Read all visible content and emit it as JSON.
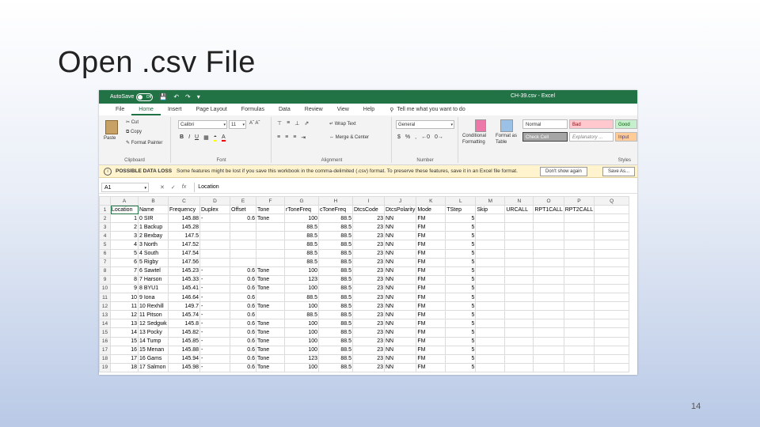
{
  "slide": {
    "title": "Open .csv File",
    "page_number": "14"
  },
  "excel": {
    "titlebar": {
      "autosave": "AutoSave",
      "toggle": "Off",
      "doc_title": "CH-39.csv - Excel"
    },
    "tabs": [
      "File",
      "Home",
      "Insert",
      "Page Layout",
      "Formulas",
      "Data",
      "Review",
      "View",
      "Help"
    ],
    "tell_me": "Tell me what you want to do",
    "ribbon": {
      "clipboard": {
        "paste": "Paste",
        "cut": "Cut",
        "copy": "Copy",
        "format_painter": "Format Painter",
        "label": "Clipboard"
      },
      "font": {
        "name": "Calibri",
        "size": "11",
        "label": "Font"
      },
      "alignment": {
        "wrap": "Wrap Text",
        "merge": "Merge & Center",
        "label": "Alignment"
      },
      "number": {
        "format": "General",
        "label": "Number"
      },
      "styles": {
        "conditional": "Conditional Formatting",
        "format_as_table": "Format as Table",
        "normal": "Normal",
        "bad": "Bad",
        "good": "Good",
        "check_cell": "Check Cell",
        "explanatory": "Explanatory ...",
        "input": "Input",
        "label": "Styles"
      }
    },
    "warning": {
      "title": "POSSIBLE DATA LOSS",
      "message": "Some features might be lost if you save this workbook in the comma-delimited (.csv) format. To preserve these features, save it in an Excel file format.",
      "dont_show": "Don't show again",
      "save_as": "Save As..."
    },
    "formula": {
      "name_box": "A1",
      "content": "Location"
    },
    "columns": [
      "A",
      "B",
      "C",
      "D",
      "E",
      "F",
      "G",
      "H",
      "I",
      "J",
      "K",
      "L",
      "M",
      "N",
      "O",
      "P",
      "Q"
    ],
    "headers": [
      "Location",
      "Name",
      "Frequency",
      "Duplex",
      "Offset",
      "Tone",
      "rToneFreq",
      "cToneFreq",
      "DtcsCode",
      "DtcsPolarity",
      "Mode",
      "TStep",
      "Skip",
      "URCALL",
      "RPT1CALL",
      "RPT2CALL",
      ""
    ],
    "rows": [
      [
        "1",
        "0 SIR",
        "145.88",
        "-",
        "0.6",
        "Tone",
        "100",
        "88.5",
        "23",
        "NN",
        "FM",
        "5",
        "",
        "",
        "",
        "",
        ""
      ],
      [
        "2",
        "1 Backup",
        "145.28",
        "",
        "",
        "",
        "88.5",
        "88.5",
        "23",
        "NN",
        "FM",
        "5",
        "",
        "",
        "",
        "",
        ""
      ],
      [
        "3",
        "2 Bexbay",
        "147.5",
        "",
        "",
        "",
        "88.5",
        "88.5",
        "23",
        "NN",
        "FM",
        "5",
        "",
        "",
        "",
        "",
        ""
      ],
      [
        "4",
        "3 North",
        "147.52",
        "",
        "",
        "",
        "88.5",
        "88.5",
        "23",
        "NN",
        "FM",
        "5",
        "",
        "",
        "",
        "",
        ""
      ],
      [
        "5",
        "4 South",
        "147.54",
        "",
        "",
        "",
        "88.5",
        "88.5",
        "23",
        "NN",
        "FM",
        "5",
        "",
        "",
        "",
        "",
        ""
      ],
      [
        "6",
        "5 Rigby",
        "147.56",
        "",
        "",
        "",
        "88.5",
        "88.5",
        "23",
        "NN",
        "FM",
        "5",
        "",
        "",
        "",
        "",
        ""
      ],
      [
        "7",
        "6 Sawtel",
        "145.23",
        "-",
        "0.6",
        "Tone",
        "100",
        "88.5",
        "23",
        "NN",
        "FM",
        "5",
        "",
        "",
        "",
        "",
        ""
      ],
      [
        "8",
        "7 Harson",
        "145.33",
        "-",
        "0.6",
        "Tone",
        "123",
        "88.5",
        "23",
        "NN",
        "FM",
        "5",
        "",
        "",
        "",
        "",
        ""
      ],
      [
        "9",
        "8 BYU1",
        "145.41",
        "-",
        "0.6",
        "Tone",
        "100",
        "88.5",
        "23",
        "NN",
        "FM",
        "5",
        "",
        "",
        "",
        "",
        ""
      ],
      [
        "10",
        "9 Iona",
        "146.64",
        "-",
        "0.6",
        "",
        "88.5",
        "88.5",
        "23",
        "NN",
        "FM",
        "5",
        "",
        "",
        "",
        "",
        ""
      ],
      [
        "11",
        "10 Rexhill",
        "149.7",
        "-",
        "0.6",
        "Tone",
        "100",
        "88.5",
        "23",
        "NN",
        "FM",
        "5",
        "",
        "",
        "",
        "",
        ""
      ],
      [
        "12",
        "11 Pitson",
        "145.74",
        "-",
        "0.6",
        "",
        "88.5",
        "88.5",
        "23",
        "NN",
        "FM",
        "5",
        "",
        "",
        "",
        "",
        ""
      ],
      [
        "13",
        "12 Sedgwk",
        "145.8",
        "-",
        "0.6",
        "Tone",
        "100",
        "88.5",
        "23",
        "NN",
        "FM",
        "5",
        "",
        "",
        "",
        "",
        ""
      ],
      [
        "14",
        "13 Pocky",
        "145.82",
        "-",
        "0.6",
        "Tone",
        "100",
        "88.5",
        "23",
        "NN",
        "FM",
        "5",
        "",
        "",
        "",
        "",
        ""
      ],
      [
        "15",
        "14 Tump",
        "145.85",
        "-",
        "0.6",
        "Tone",
        "100",
        "88.5",
        "23",
        "NN",
        "FM",
        "5",
        "",
        "",
        "",
        "",
        ""
      ],
      [
        "16",
        "15 Menan",
        "145.88",
        "-",
        "0.6",
        "Tone",
        "100",
        "88.5",
        "23",
        "NN",
        "FM",
        "5",
        "",
        "",
        "",
        "",
        ""
      ],
      [
        "17",
        "16 Gams",
        "145.94",
        "-",
        "0.6",
        "Tone",
        "123",
        "88.5",
        "23",
        "NN",
        "FM",
        "5",
        "",
        "",
        "",
        "",
        ""
      ],
      [
        "18",
        "17 Salmon",
        "145.98",
        "-",
        "0.6",
        "Tone",
        "100",
        "88.5",
        "23",
        "NN",
        "FM",
        "5",
        "",
        "",
        "",
        "",
        ""
      ]
    ],
    "colors": {
      "excel_green": "#217346",
      "warning_bg": "#fff4ce",
      "bad_bg": "#ffc7ce",
      "good_bg": "#c6efce",
      "check_bg": "#a5a5a5",
      "input_bg": "#ffcc99"
    }
  }
}
